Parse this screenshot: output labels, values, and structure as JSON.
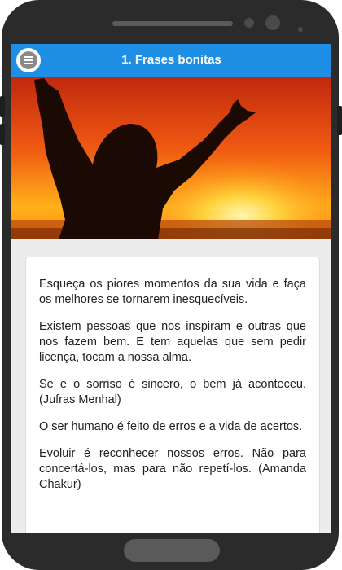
{
  "app": {
    "title": "1. Frases bonitas"
  },
  "phrases": [
    "Esqueça os piores momentos da sua vida e faça os melhores se tornarem inesquecíveis.",
    "Existem pessoas que nos inspiram e outras que nos fazem bem. E tem aquelas que sem pedir licença, tocam a nossa alma.",
    "Se e o sorriso é sincero, o bem já aconteceu. (Jufras Menhal)",
    "O ser humano é feito de erros e a vida de acertos.",
    "Evoluir é reconhecer nossos erros. Não para concertá-los, mas para não repetí-los. (Amanda Chakur)"
  ],
  "icons": {
    "menu": "menu-icon"
  },
  "colors": {
    "appbar": "#1f8fe6",
    "background": "#ececec"
  }
}
